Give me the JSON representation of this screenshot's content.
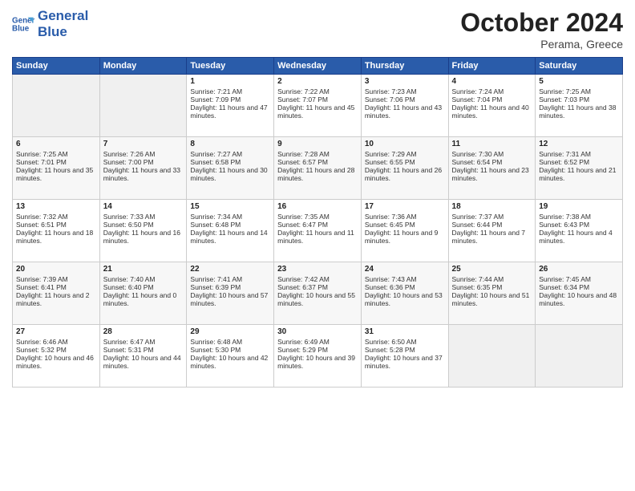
{
  "header": {
    "logo_line1": "General",
    "logo_line2": "Blue",
    "month": "October 2024",
    "location": "Perama, Greece"
  },
  "days_of_week": [
    "Sunday",
    "Monday",
    "Tuesday",
    "Wednesday",
    "Thursday",
    "Friday",
    "Saturday"
  ],
  "weeks": [
    [
      {
        "day": "",
        "sunrise": "",
        "sunset": "",
        "daylight": "",
        "empty": true
      },
      {
        "day": "",
        "sunrise": "",
        "sunset": "",
        "daylight": "",
        "empty": true
      },
      {
        "day": "1",
        "sunrise": "Sunrise: 7:21 AM",
        "sunset": "Sunset: 7:09 PM",
        "daylight": "Daylight: 11 hours and 47 minutes."
      },
      {
        "day": "2",
        "sunrise": "Sunrise: 7:22 AM",
        "sunset": "Sunset: 7:07 PM",
        "daylight": "Daylight: 11 hours and 45 minutes."
      },
      {
        "day": "3",
        "sunrise": "Sunrise: 7:23 AM",
        "sunset": "Sunset: 7:06 PM",
        "daylight": "Daylight: 11 hours and 43 minutes."
      },
      {
        "day": "4",
        "sunrise": "Sunrise: 7:24 AM",
        "sunset": "Sunset: 7:04 PM",
        "daylight": "Daylight: 11 hours and 40 minutes."
      },
      {
        "day": "5",
        "sunrise": "Sunrise: 7:25 AM",
        "sunset": "Sunset: 7:03 PM",
        "daylight": "Daylight: 11 hours and 38 minutes."
      }
    ],
    [
      {
        "day": "6",
        "sunrise": "Sunrise: 7:25 AM",
        "sunset": "Sunset: 7:01 PM",
        "daylight": "Daylight: 11 hours and 35 minutes."
      },
      {
        "day": "7",
        "sunrise": "Sunrise: 7:26 AM",
        "sunset": "Sunset: 7:00 PM",
        "daylight": "Daylight: 11 hours and 33 minutes."
      },
      {
        "day": "8",
        "sunrise": "Sunrise: 7:27 AM",
        "sunset": "Sunset: 6:58 PM",
        "daylight": "Daylight: 11 hours and 30 minutes."
      },
      {
        "day": "9",
        "sunrise": "Sunrise: 7:28 AM",
        "sunset": "Sunset: 6:57 PM",
        "daylight": "Daylight: 11 hours and 28 minutes."
      },
      {
        "day": "10",
        "sunrise": "Sunrise: 7:29 AM",
        "sunset": "Sunset: 6:55 PM",
        "daylight": "Daylight: 11 hours and 26 minutes."
      },
      {
        "day": "11",
        "sunrise": "Sunrise: 7:30 AM",
        "sunset": "Sunset: 6:54 PM",
        "daylight": "Daylight: 11 hours and 23 minutes."
      },
      {
        "day": "12",
        "sunrise": "Sunrise: 7:31 AM",
        "sunset": "Sunset: 6:52 PM",
        "daylight": "Daylight: 11 hours and 21 minutes."
      }
    ],
    [
      {
        "day": "13",
        "sunrise": "Sunrise: 7:32 AM",
        "sunset": "Sunset: 6:51 PM",
        "daylight": "Daylight: 11 hours and 18 minutes."
      },
      {
        "day": "14",
        "sunrise": "Sunrise: 7:33 AM",
        "sunset": "Sunset: 6:50 PM",
        "daylight": "Daylight: 11 hours and 16 minutes."
      },
      {
        "day": "15",
        "sunrise": "Sunrise: 7:34 AM",
        "sunset": "Sunset: 6:48 PM",
        "daylight": "Daylight: 11 hours and 14 minutes."
      },
      {
        "day": "16",
        "sunrise": "Sunrise: 7:35 AM",
        "sunset": "Sunset: 6:47 PM",
        "daylight": "Daylight: 11 hours and 11 minutes."
      },
      {
        "day": "17",
        "sunrise": "Sunrise: 7:36 AM",
        "sunset": "Sunset: 6:45 PM",
        "daylight": "Daylight: 11 hours and 9 minutes."
      },
      {
        "day": "18",
        "sunrise": "Sunrise: 7:37 AM",
        "sunset": "Sunset: 6:44 PM",
        "daylight": "Daylight: 11 hours and 7 minutes."
      },
      {
        "day": "19",
        "sunrise": "Sunrise: 7:38 AM",
        "sunset": "Sunset: 6:43 PM",
        "daylight": "Daylight: 11 hours and 4 minutes."
      }
    ],
    [
      {
        "day": "20",
        "sunrise": "Sunrise: 7:39 AM",
        "sunset": "Sunset: 6:41 PM",
        "daylight": "Daylight: 11 hours and 2 minutes."
      },
      {
        "day": "21",
        "sunrise": "Sunrise: 7:40 AM",
        "sunset": "Sunset: 6:40 PM",
        "daylight": "Daylight: 11 hours and 0 minutes."
      },
      {
        "day": "22",
        "sunrise": "Sunrise: 7:41 AM",
        "sunset": "Sunset: 6:39 PM",
        "daylight": "Daylight: 10 hours and 57 minutes."
      },
      {
        "day": "23",
        "sunrise": "Sunrise: 7:42 AM",
        "sunset": "Sunset: 6:37 PM",
        "daylight": "Daylight: 10 hours and 55 minutes."
      },
      {
        "day": "24",
        "sunrise": "Sunrise: 7:43 AM",
        "sunset": "Sunset: 6:36 PM",
        "daylight": "Daylight: 10 hours and 53 minutes."
      },
      {
        "day": "25",
        "sunrise": "Sunrise: 7:44 AM",
        "sunset": "Sunset: 6:35 PM",
        "daylight": "Daylight: 10 hours and 51 minutes."
      },
      {
        "day": "26",
        "sunrise": "Sunrise: 7:45 AM",
        "sunset": "Sunset: 6:34 PM",
        "daylight": "Daylight: 10 hours and 48 minutes."
      }
    ],
    [
      {
        "day": "27",
        "sunrise": "Sunrise: 6:46 AM",
        "sunset": "Sunset: 5:32 PM",
        "daylight": "Daylight: 10 hours and 46 minutes."
      },
      {
        "day": "28",
        "sunrise": "Sunrise: 6:47 AM",
        "sunset": "Sunset: 5:31 PM",
        "daylight": "Daylight: 10 hours and 44 minutes."
      },
      {
        "day": "29",
        "sunrise": "Sunrise: 6:48 AM",
        "sunset": "Sunset: 5:30 PM",
        "daylight": "Daylight: 10 hours and 42 minutes."
      },
      {
        "day": "30",
        "sunrise": "Sunrise: 6:49 AM",
        "sunset": "Sunset: 5:29 PM",
        "daylight": "Daylight: 10 hours and 39 minutes."
      },
      {
        "day": "31",
        "sunrise": "Sunrise: 6:50 AM",
        "sunset": "Sunset: 5:28 PM",
        "daylight": "Daylight: 10 hours and 37 minutes."
      },
      {
        "day": "",
        "sunrise": "",
        "sunset": "",
        "daylight": "",
        "empty": true
      },
      {
        "day": "",
        "sunrise": "",
        "sunset": "",
        "daylight": "",
        "empty": true
      }
    ]
  ]
}
